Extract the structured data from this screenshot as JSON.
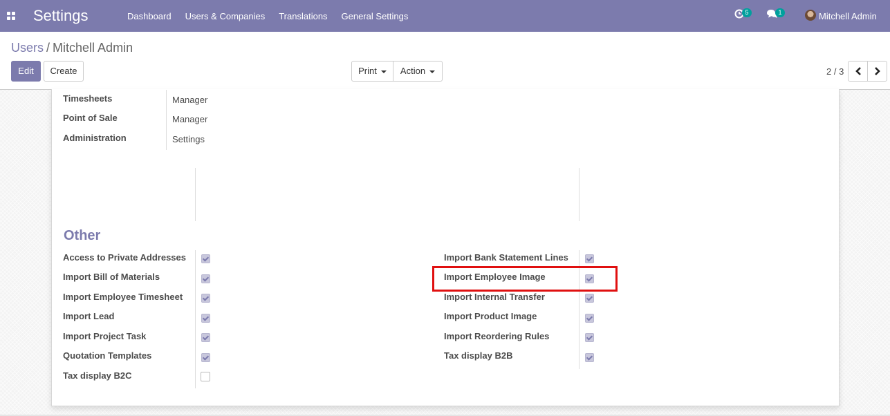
{
  "navbar": {
    "brand": "Settings",
    "menu": [
      "Dashboard",
      "Users & Companies",
      "Translations",
      "General Settings"
    ],
    "activity_count": "5",
    "messages_count": "1",
    "user_name": "Mitchell Admin",
    "icons": [
      "apps-icon",
      "clock-icon",
      "chat-icon",
      "avatar"
    ]
  },
  "breadcrumb": {
    "parent": "Users",
    "separator": "/",
    "current": "Mitchell Admin"
  },
  "buttons": {
    "edit": "Edit",
    "create": "Create",
    "print": "Print",
    "action": "Action"
  },
  "pager": {
    "value": "2 / 3"
  },
  "access_rights": [
    {
      "label": "Timesheets",
      "value": "Manager"
    },
    {
      "label": "Point of Sale",
      "value": "Manager"
    },
    {
      "label": "Administration",
      "value": "Settings"
    }
  ],
  "other": {
    "title": "Other",
    "left": [
      {
        "label": "Access to Private Addresses",
        "checked": true
      },
      {
        "label": "Import Bill of Materials",
        "checked": true
      },
      {
        "label": "Import Employee Timesheet",
        "checked": true
      },
      {
        "label": "Import Lead",
        "checked": true
      },
      {
        "label": "Import Project Task",
        "checked": true
      },
      {
        "label": "Quotation Templates",
        "checked": true
      },
      {
        "label": "Tax display B2C",
        "checked": false
      }
    ],
    "right": [
      {
        "label": "Import Bank Statement Lines",
        "checked": true
      },
      {
        "label": "Import Employee Image",
        "checked": true
      },
      {
        "label": "Import Internal Transfer",
        "checked": true
      },
      {
        "label": "Import Product Image",
        "checked": true
      },
      {
        "label": "Import Reordering Rules",
        "checked": true
      },
      {
        "label": "Tax display B2B",
        "checked": true
      }
    ]
  },
  "colors": {
    "primary": "#7c7bad",
    "badge": "#00a09d",
    "highlight": "#e01010"
  }
}
